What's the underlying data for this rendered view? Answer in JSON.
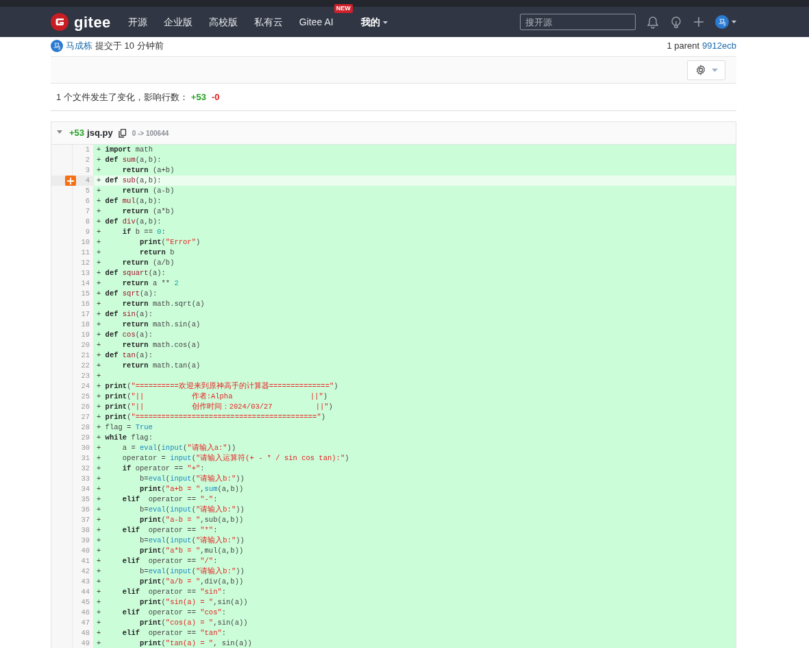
{
  "navbar": {
    "logo": "gitee",
    "items": [
      {
        "label": "开源",
        "selected": false,
        "dropdown": false
      },
      {
        "label": "企业版",
        "selected": false,
        "dropdown": false
      },
      {
        "label": "高校版",
        "selected": false,
        "dropdown": false
      },
      {
        "label": "私有云",
        "selected": false,
        "dropdown": false
      },
      {
        "label": "Gitee AI",
        "selected": false,
        "dropdown": false,
        "badge": "NEW"
      },
      {
        "label": "我的",
        "selected": true,
        "dropdown": true
      }
    ],
    "search": {
      "placeholder": "搜开源"
    },
    "avatar": "马"
  },
  "commit": {
    "avatar": "马",
    "author": "马成栋",
    "time": "提交于 10 分钟前",
    "parent_label": "1 parent",
    "parent": "9912ecb"
  },
  "summary": {
    "text": "1 个文件发生了变化，影响行数：",
    "added": "+53",
    "removed": "-0"
  },
  "file": {
    "expanded": true,
    "added": "+53",
    "name": "jsq.py",
    "mode": "0 -> 100644",
    "lines": [
      {
        "number": "1",
        "sign": "+",
        "hovered": false,
        "tokens": [
          {
            "kind": "keyword",
            "text": "import"
          },
          {
            "kind": "plain",
            "text": " math"
          }
        ]
      },
      {
        "number": "2",
        "sign": "+",
        "hovered": false,
        "tokens": [
          {
            "kind": "keyword",
            "text": "def"
          },
          {
            "kind": "function",
            "text": " sum"
          },
          {
            "kind": "plain",
            "text": "(a,b):"
          }
        ]
      },
      {
        "number": "3",
        "sign": "+",
        "hovered": false,
        "tokens": [
          {
            "kind": "keyword",
            "text": "    return"
          },
          {
            "kind": "plain",
            "text": " (a+b)"
          }
        ]
      },
      {
        "number": "4",
        "sign": "+",
        "hovered": true,
        "tokens": [
          {
            "kind": "keyword",
            "text": "def"
          },
          {
            "kind": "function",
            "text": " sub"
          },
          {
            "kind": "plain",
            "text": "(a,b):"
          }
        ]
      },
      {
        "number": "5",
        "sign": "+",
        "hovered": false,
        "tokens": [
          {
            "kind": "keyword",
            "text": "    return"
          },
          {
            "kind": "plain",
            "text": " (a-b)"
          }
        ]
      },
      {
        "number": "6",
        "sign": "+",
        "hovered": false,
        "tokens": [
          {
            "kind": "keyword",
            "text": "def"
          },
          {
            "kind": "function",
            "text": " mul"
          },
          {
            "kind": "plain",
            "text": "(a,b):"
          }
        ]
      },
      {
        "number": "7",
        "sign": "+",
        "hovered": false,
        "tokens": [
          {
            "kind": "keyword",
            "text": "    return"
          },
          {
            "kind": "plain",
            "text": " (a*b)"
          }
        ]
      },
      {
        "number": "8",
        "sign": "+",
        "hovered": false,
        "tokens": [
          {
            "kind": "keyword",
            "text": "def"
          },
          {
            "kind": "function",
            "text": " div"
          },
          {
            "kind": "plain",
            "text": "(a,b):"
          }
        ]
      },
      {
        "number": "9",
        "sign": "+",
        "hovered": false,
        "tokens": [
          {
            "kind": "keyword",
            "text": "    if"
          },
          {
            "kind": "plain",
            "text": " b == "
          },
          {
            "kind": "number",
            "text": "0"
          },
          {
            "kind": "plain",
            "text": ":"
          }
        ]
      },
      {
        "number": "10",
        "sign": "+",
        "hovered": false,
        "tokens": [
          {
            "kind": "keyword",
            "text": "        print"
          },
          {
            "kind": "plain",
            "text": "("
          },
          {
            "kind": "string",
            "text": "\"Error\""
          },
          {
            "kind": "plain",
            "text": ")"
          }
        ]
      },
      {
        "number": "11",
        "sign": "+",
        "hovered": false,
        "tokens": [
          {
            "kind": "keyword",
            "text": "        return"
          },
          {
            "kind": "plain",
            "text": " b"
          }
        ]
      },
      {
        "number": "12",
        "sign": "+",
        "hovered": false,
        "tokens": [
          {
            "kind": "keyword",
            "text": "    return"
          },
          {
            "kind": "plain",
            "text": " (a/b)"
          }
        ]
      },
      {
        "number": "13",
        "sign": "+",
        "hovered": false,
        "tokens": [
          {
            "kind": "keyword",
            "text": "def"
          },
          {
            "kind": "function",
            "text": " squart"
          },
          {
            "kind": "plain",
            "text": "(a):"
          }
        ]
      },
      {
        "number": "14",
        "sign": "+",
        "hovered": false,
        "tokens": [
          {
            "kind": "keyword",
            "text": "    return"
          },
          {
            "kind": "plain",
            "text": " a ** "
          },
          {
            "kind": "number",
            "text": "2"
          }
        ]
      },
      {
        "number": "15",
        "sign": "+",
        "hovered": false,
        "tokens": [
          {
            "kind": "keyword",
            "text": "def"
          },
          {
            "kind": "function",
            "text": " sqrt"
          },
          {
            "kind": "plain",
            "text": "(a):"
          }
        ]
      },
      {
        "number": "16",
        "sign": "+",
        "hovered": false,
        "tokens": [
          {
            "kind": "keyword",
            "text": "    return"
          },
          {
            "kind": "plain",
            "text": " math.sqrt(a)"
          }
        ]
      },
      {
        "number": "17",
        "sign": "+",
        "hovered": false,
        "tokens": [
          {
            "kind": "keyword",
            "text": "def"
          },
          {
            "kind": "function",
            "text": " sin"
          },
          {
            "kind": "plain",
            "text": "(a):"
          }
        ]
      },
      {
        "number": "18",
        "sign": "+",
        "hovered": false,
        "tokens": [
          {
            "kind": "keyword",
            "text": "    return"
          },
          {
            "kind": "plain",
            "text": " math.sin(a)"
          }
        ]
      },
      {
        "number": "19",
        "sign": "+",
        "hovered": false,
        "tokens": [
          {
            "kind": "keyword",
            "text": "def"
          },
          {
            "kind": "function",
            "text": " cos"
          },
          {
            "kind": "plain",
            "text": "(a):"
          }
        ]
      },
      {
        "number": "20",
        "sign": "+",
        "hovered": false,
        "tokens": [
          {
            "kind": "keyword",
            "text": "    return"
          },
          {
            "kind": "plain",
            "text": " math.cos(a)"
          }
        ]
      },
      {
        "number": "21",
        "sign": "+",
        "hovered": false,
        "tokens": [
          {
            "kind": "keyword",
            "text": "def"
          },
          {
            "kind": "function",
            "text": " tan"
          },
          {
            "kind": "plain",
            "text": "(a):"
          }
        ]
      },
      {
        "number": "22",
        "sign": "+",
        "hovered": false,
        "tokens": [
          {
            "kind": "keyword",
            "text": "    return"
          },
          {
            "kind": "plain",
            "text": " math.tan(a)"
          }
        ]
      },
      {
        "number": "23",
        "sign": "+",
        "hovered": false
      },
      {
        "number": "24",
        "sign": "+",
        "hovered": false,
        "tokens": [
          {
            "kind": "keyword",
            "text": "print"
          },
          {
            "kind": "plain",
            "text": "("
          },
          {
            "kind": "string",
            "text": "\"==========欢迎来到原神高手的计算器==============\""
          },
          {
            "kind": "plain",
            "text": ")"
          }
        ]
      },
      {
        "number": "25",
        "sign": "+",
        "hovered": false,
        "tokens": [
          {
            "kind": "keyword",
            "text": "print"
          },
          {
            "kind": "plain",
            "text": "("
          },
          {
            "kind": "string",
            "text": "\"||           作者:Alpha                  ||\""
          },
          {
            "kind": "plain",
            "text": ")"
          }
        ]
      },
      {
        "number": "26",
        "sign": "+",
        "hovered": false,
        "tokens": [
          {
            "kind": "keyword",
            "text": "print"
          },
          {
            "kind": "plain",
            "text": "("
          },
          {
            "kind": "string",
            "text": "\"||           创作时间：2024/03/27          ||\""
          },
          {
            "kind": "plain",
            "text": ")"
          }
        ]
      },
      {
        "number": "27",
        "sign": "+",
        "hovered": false,
        "tokens": [
          {
            "kind": "keyword",
            "text": "print"
          },
          {
            "kind": "plain",
            "text": "("
          },
          {
            "kind": "string",
            "text": "\"==========================================\""
          },
          {
            "kind": "plain",
            "text": ")"
          }
        ]
      },
      {
        "number": "28",
        "sign": "+",
        "hovered": false,
        "tokens": [
          {
            "kind": "plain",
            "text": "flag = "
          },
          {
            "kind": "builtin",
            "text": "True"
          }
        ]
      },
      {
        "number": "29",
        "sign": "+",
        "hovered": false,
        "tokens": [
          {
            "kind": "keyword",
            "text": "while"
          },
          {
            "kind": "plain",
            "text": " flag:"
          }
        ]
      },
      {
        "number": "30",
        "sign": "+",
        "hovered": false,
        "tokens": [
          {
            "kind": "plain",
            "text": "    a = "
          },
          {
            "kind": "builtin",
            "text": "eval"
          },
          {
            "kind": "plain",
            "text": "("
          },
          {
            "kind": "builtin",
            "text": "input"
          },
          {
            "kind": "plain",
            "text": "("
          },
          {
            "kind": "string",
            "text": "\"请输入a:\""
          },
          {
            "kind": "plain",
            "text": "))"
          }
        ]
      },
      {
        "number": "31",
        "sign": "+",
        "hovered": false,
        "tokens": [
          {
            "kind": "plain",
            "text": "    operator = "
          },
          {
            "kind": "builtin",
            "text": "input"
          },
          {
            "kind": "plain",
            "text": "("
          },
          {
            "kind": "string",
            "text": "\"请输入运算符(+ - * / sin cos tan):\""
          },
          {
            "kind": "plain",
            "text": ")"
          }
        ]
      },
      {
        "number": "32",
        "sign": "+",
        "hovered": false,
        "tokens": [
          {
            "kind": "keyword",
            "text": "    if"
          },
          {
            "kind": "plain",
            "text": " operator == "
          },
          {
            "kind": "string",
            "text": "\"+\""
          },
          {
            "kind": "plain",
            "text": ":"
          }
        ]
      },
      {
        "number": "33",
        "sign": "+",
        "hovered": false,
        "tokens": [
          {
            "kind": "plain",
            "text": "        b="
          },
          {
            "kind": "builtin",
            "text": "eval"
          },
          {
            "kind": "plain",
            "text": "("
          },
          {
            "kind": "builtin",
            "text": "input"
          },
          {
            "kind": "plain",
            "text": "("
          },
          {
            "kind": "string",
            "text": "\"请输入b:\""
          },
          {
            "kind": "plain",
            "text": "))"
          }
        ]
      },
      {
        "number": "34",
        "sign": "+",
        "hovered": false,
        "tokens": [
          {
            "kind": "keyword",
            "text": "        print"
          },
          {
            "kind": "plain",
            "text": "("
          },
          {
            "kind": "string",
            "text": "\"a+b = \""
          },
          {
            "kind": "plain",
            "text": ","
          },
          {
            "kind": "builtin",
            "text": "sum"
          },
          {
            "kind": "plain",
            "text": "(a,b))"
          }
        ]
      },
      {
        "number": "35",
        "sign": "+",
        "hovered": false,
        "tokens": [
          {
            "kind": "keyword",
            "text": "    elif"
          },
          {
            "kind": "plain",
            "text": "  operator == "
          },
          {
            "kind": "string",
            "text": "\"-\""
          },
          {
            "kind": "plain",
            "text": ":"
          }
        ]
      },
      {
        "number": "36",
        "sign": "+",
        "hovered": false,
        "tokens": [
          {
            "kind": "plain",
            "text": "        b="
          },
          {
            "kind": "builtin",
            "text": "eval"
          },
          {
            "kind": "plain",
            "text": "("
          },
          {
            "kind": "builtin",
            "text": "input"
          },
          {
            "kind": "plain",
            "text": "("
          },
          {
            "kind": "string",
            "text": "\"请输入b:\""
          },
          {
            "kind": "plain",
            "text": "))"
          }
        ]
      },
      {
        "number": "37",
        "sign": "+",
        "hovered": false,
        "tokens": [
          {
            "kind": "keyword",
            "text": "        print"
          },
          {
            "kind": "plain",
            "text": "("
          },
          {
            "kind": "string",
            "text": "\"a-b = \""
          },
          {
            "kind": "plain",
            "text": ",sub(a,b))"
          }
        ]
      },
      {
        "number": "38",
        "sign": "+",
        "hovered": false,
        "tokens": [
          {
            "kind": "keyword",
            "text": "    elif"
          },
          {
            "kind": "plain",
            "text": "  operator == "
          },
          {
            "kind": "string",
            "text": "\"*\""
          },
          {
            "kind": "plain",
            "text": ":"
          }
        ]
      },
      {
        "number": "39",
        "sign": "+",
        "hovered": false,
        "tokens": [
          {
            "kind": "plain",
            "text": "        b="
          },
          {
            "kind": "builtin",
            "text": "eval"
          },
          {
            "kind": "plain",
            "text": "("
          },
          {
            "kind": "builtin",
            "text": "input"
          },
          {
            "kind": "plain",
            "text": "("
          },
          {
            "kind": "string",
            "text": "\"请输入b:\""
          },
          {
            "kind": "plain",
            "text": "))"
          }
        ]
      },
      {
        "number": "40",
        "sign": "+",
        "hovered": false,
        "tokens": [
          {
            "kind": "keyword",
            "text": "        print"
          },
          {
            "kind": "plain",
            "text": "("
          },
          {
            "kind": "string",
            "text": "\"a*b = \""
          },
          {
            "kind": "plain",
            "text": ",mul(a,b))"
          }
        ]
      },
      {
        "number": "41",
        "sign": "+",
        "hovered": false,
        "tokens": [
          {
            "kind": "keyword",
            "text": "    elif"
          },
          {
            "kind": "plain",
            "text": "  operator == "
          },
          {
            "kind": "string",
            "text": "\"/\""
          },
          {
            "kind": "plain",
            "text": ":"
          }
        ]
      },
      {
        "number": "42",
        "sign": "+",
        "hovered": false,
        "tokens": [
          {
            "kind": "plain",
            "text": "        b="
          },
          {
            "kind": "builtin",
            "text": "eval"
          },
          {
            "kind": "plain",
            "text": "("
          },
          {
            "kind": "builtin",
            "text": "input"
          },
          {
            "kind": "plain",
            "text": "("
          },
          {
            "kind": "string",
            "text": "\"请输入b:\""
          },
          {
            "kind": "plain",
            "text": "))"
          }
        ]
      },
      {
        "number": "43",
        "sign": "+",
        "hovered": false,
        "tokens": [
          {
            "kind": "keyword",
            "text": "        print"
          },
          {
            "kind": "plain",
            "text": "("
          },
          {
            "kind": "string",
            "text": "\"a/b = \""
          },
          {
            "kind": "plain",
            "text": ",div(a,b))"
          }
        ]
      },
      {
        "number": "44",
        "sign": "+",
        "hovered": false,
        "tokens": [
          {
            "kind": "keyword",
            "text": "    elif"
          },
          {
            "kind": "plain",
            "text": "  operator == "
          },
          {
            "kind": "string",
            "text": "\"sin\""
          },
          {
            "kind": "plain",
            "text": ":"
          }
        ]
      },
      {
        "number": "45",
        "sign": "+",
        "hovered": false,
        "tokens": [
          {
            "kind": "keyword",
            "text": "        print"
          },
          {
            "kind": "plain",
            "text": "("
          },
          {
            "kind": "string",
            "text": "\"sin(a) = \""
          },
          {
            "kind": "plain",
            "text": ",sin(a))"
          }
        ]
      },
      {
        "number": "46",
        "sign": "+",
        "hovered": false,
        "tokens": [
          {
            "kind": "keyword",
            "text": "    elif"
          },
          {
            "kind": "plain",
            "text": "  operator == "
          },
          {
            "kind": "string",
            "text": "\"cos\""
          },
          {
            "kind": "plain",
            "text": ":"
          }
        ]
      },
      {
        "number": "47",
        "sign": "+",
        "hovered": false,
        "tokens": [
          {
            "kind": "keyword",
            "text": "        print"
          },
          {
            "kind": "plain",
            "text": "("
          },
          {
            "kind": "string",
            "text": "\"cos(a) = \""
          },
          {
            "kind": "plain",
            "text": ",sin(a))"
          }
        ]
      },
      {
        "number": "48",
        "sign": "+",
        "hovered": false,
        "tokens": [
          {
            "kind": "keyword",
            "text": "    elif"
          },
          {
            "kind": "plain",
            "text": "  operator == "
          },
          {
            "kind": "string",
            "text": "\"tan\""
          },
          {
            "kind": "plain",
            "text": ":"
          }
        ]
      },
      {
        "number": "49",
        "sign": "+",
        "hovered": false,
        "tokens": [
          {
            "kind": "keyword",
            "text": "        print"
          },
          {
            "kind": "plain",
            "text": "("
          },
          {
            "kind": "string",
            "text": "\"tan(a) = \""
          },
          {
            "kind": "plain",
            "text": ", sin(a))"
          }
        ]
      }
    ]
  }
}
